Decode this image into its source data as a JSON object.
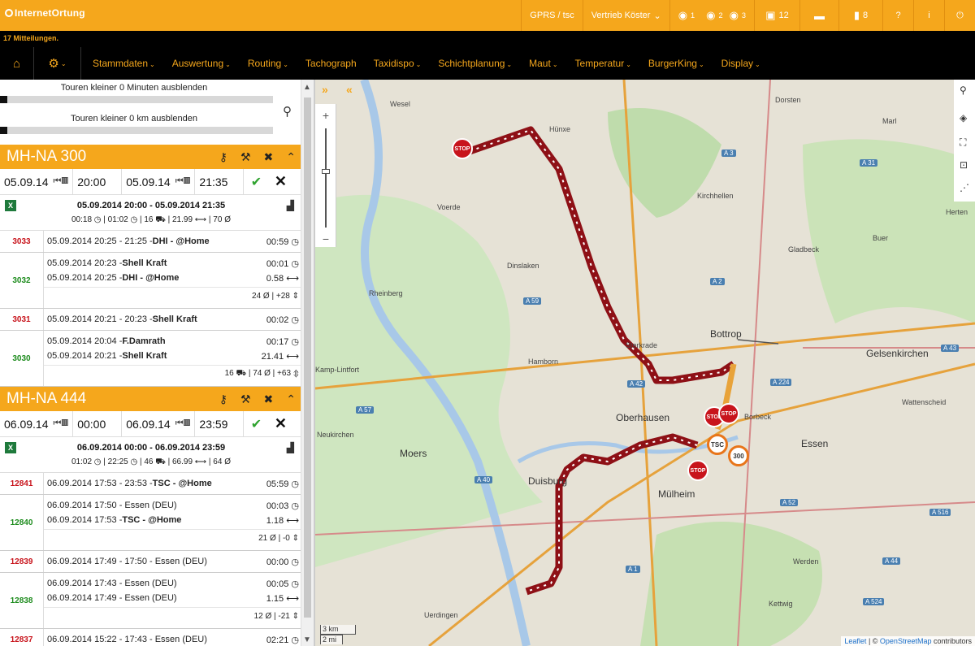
{
  "app": {
    "logo": "InternetOrtung"
  },
  "topbar": {
    "gprs": "GPRS / tsc",
    "user": "Vertrieb Köster",
    "icons": [
      "globe-1-icon",
      "globe-2-icon",
      "globe-3-icon"
    ],
    "messages_count": "12",
    "alerts_count": "8"
  },
  "message_bar": {
    "text": "17 Mitteilungen."
  },
  "nav": {
    "items": [
      "Stammdaten",
      "Auswertung",
      "Routing",
      "Tachograph",
      "Taxidispo",
      "Schichtplanung",
      "Maut",
      "Temperatur",
      "BurgerKing",
      "Display"
    ],
    "has_caret": [
      true,
      true,
      true,
      false,
      true,
      true,
      true,
      true,
      true,
      true
    ]
  },
  "filters": {
    "minutes_label": "Touren kleiner 0 Minuten ausblenden",
    "km_label": "Touren kleiner 0 km ausblenden"
  },
  "tours": [
    {
      "name": "MH-NA 300",
      "from_date": "05.09.14",
      "from_time": "20:00",
      "to_date": "05.09.14",
      "to_time": "21:35",
      "range": "05.09.2014 20:00 - 05.09.2014 21:35",
      "stats": "00:18 ◷ | 01:02 ◷ | 16 ⛟ | 21.99 ⟷ | 70 Ø",
      "stops": [
        {
          "id": "3033",
          "color": "red",
          "lines": [
            {
              "text": "05.09.2014 20:25 - 21:25 - ",
              "bold": "DHI - @Home",
              "dur": "00:59 ◷"
            }
          ],
          "foot": ""
        },
        {
          "id": "3032",
          "color": "green",
          "lines": [
            {
              "text": "05.09.2014 20:23 - ",
              "bold": "Shell Kraft",
              "dur": "00:01 ◷"
            },
            {
              "text": "05.09.2014 20:25 - ",
              "bold": "DHI - @Home",
              "dur": "0.58 ⟷"
            }
          ],
          "foot": "24 Ø | +28 ⇕"
        },
        {
          "id": "3031",
          "color": "red",
          "lines": [
            {
              "text": "05.09.2014 20:21 - 20:23 - ",
              "bold": "Shell Kraft",
              "dur": "00:02 ◷"
            }
          ],
          "foot": ""
        },
        {
          "id": "3030",
          "color": "green",
          "lines": [
            {
              "text": "05.09.2014 20:04 - ",
              "bold": "F.Damrath",
              "dur": "00:17 ◷"
            },
            {
              "text": "05.09.2014 20:21 - ",
              "bold": "Shell Kraft",
              "dur": "21.41 ⟷"
            }
          ],
          "foot": "16 ⛟ | 74 Ø | +63 ⇕"
        }
      ]
    },
    {
      "name": "MH-NA 444",
      "from_date": "06.09.14",
      "from_time": "00:00",
      "to_date": "06.09.14",
      "to_time": "23:59",
      "range": "06.09.2014 00:00 - 06.09.2014 23:59",
      "stats": "01:02 ◷ | 22:25 ◷ | 46 ⛟ | 66.99 ⟷ | 64 Ø",
      "stops": [
        {
          "id": "12841",
          "color": "red",
          "lines": [
            {
              "text": "06.09.2014 17:53 - 23:53 - ",
              "bold": "TSC - @Home",
              "dur": "05:59 ◷"
            }
          ],
          "foot": ""
        },
        {
          "id": "12840",
          "color": "green",
          "lines": [
            {
              "text": "06.09.2014 17:50 - Essen (DEU)",
              "bold": "",
              "dur": "00:03 ◷"
            },
            {
              "text": "06.09.2014 17:53 - ",
              "bold": "TSC - @Home",
              "dur": "1.18 ⟷"
            }
          ],
          "foot": "21 Ø | -0 ⇕"
        },
        {
          "id": "12839",
          "color": "red",
          "lines": [
            {
              "text": "06.09.2014 17:49 - 17:50 - Essen (DEU)",
              "bold": "",
              "dur": "00:00 ◷"
            }
          ],
          "foot": ""
        },
        {
          "id": "12838",
          "color": "green",
          "lines": [
            {
              "text": "06.09.2014 17:43 - Essen (DEU)",
              "bold": "",
              "dur": "00:05 ◷"
            },
            {
              "text": "06.09.2014 17:49 - Essen (DEU)",
              "bold": "",
              "dur": "1.15 ⟷"
            }
          ],
          "foot": "12 Ø | -21 ⇕"
        },
        {
          "id": "12837",
          "color": "red",
          "lines": [
            {
              "text": "06.09.2014 15:22 - 17:43 - Essen (DEU)",
              "bold": "",
              "dur": "02:21 ◷"
            }
          ],
          "foot": ""
        }
      ]
    }
  ],
  "map": {
    "cities": [
      "Bottrop",
      "Gelsenkirchen",
      "Oberhausen",
      "Essen",
      "Moers",
      "Duisburg",
      "Mülheim"
    ],
    "towns": [
      "Wesel",
      "Hünxe",
      "Dorsten",
      "Voerde",
      "Dinslaken",
      "Rheinberg",
      "Kirchhellen",
      "Gladbeck",
      "Marl",
      "Buer",
      "Herten",
      "Hamborn",
      "Kamp-Lintfort",
      "Neukirchen",
      "Wattenscheid",
      "Werden",
      "Kettwig",
      "Uerdingen",
      "Sterkrade",
      "Borbeck"
    ],
    "roads": [
      "A 3",
      "A 31",
      "A 2",
      "A 42",
      "A 59",
      "A 40",
      "A 57",
      "A 52",
      "A 44",
      "A 224",
      "A 43",
      "A 1",
      "A 516",
      "A 524"
    ],
    "markers": [
      "STOP",
      "STOP",
      "STOP",
      "TSC",
      "300",
      "STOP"
    ],
    "scale_km": "3 km",
    "scale_mi": "2 mi",
    "attribution_leaflet": "Leaflet",
    "attribution_sep": " | © ",
    "attribution_osm": "OpenStreetMap",
    "attribution_tail": " contributors"
  },
  "colors": {
    "accent": "#f5a71c",
    "route": "#c8141c",
    "nav_bg": "#000000"
  }
}
